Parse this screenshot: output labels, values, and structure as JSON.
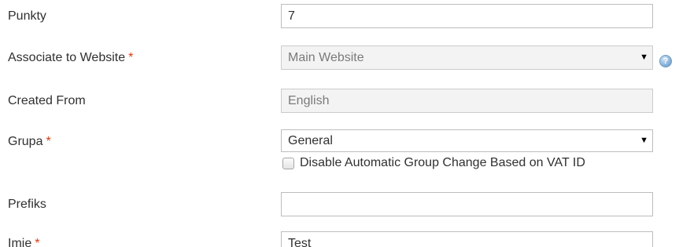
{
  "fields": {
    "points": {
      "label": "Punkty",
      "value": "7"
    },
    "website": {
      "label": "Associate to Website",
      "required_mark": "*",
      "value": "Main Website",
      "arrow": "▼",
      "help_icon": "question-mark-icon"
    },
    "created_from": {
      "label": "Created From",
      "value": "English"
    },
    "group": {
      "label": "Grupa",
      "required_mark": "*",
      "value": "General",
      "arrow": "▼"
    },
    "disable_group_change": {
      "label": "Disable Automatic Group Change Based on VAT ID",
      "checked": false
    },
    "prefix": {
      "label": "Prefiks",
      "value": ""
    },
    "first_name": {
      "label": "Imie",
      "required_mark": "*",
      "value": "Test"
    }
  },
  "colors": {
    "required": "#eb340a",
    "border": "#bdbdbd",
    "disabled_bg": "#f3f3f3",
    "help_icon": "#8db7df"
  }
}
